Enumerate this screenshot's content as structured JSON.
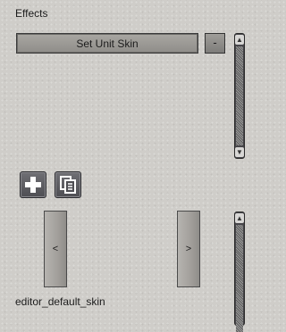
{
  "effects": {
    "title": "Effects",
    "current_effect_label": "Set Unit Skin",
    "remove_label": "-"
  },
  "scroll": {
    "up_glyph": "▲",
    "down_glyph": "▼"
  },
  "toolbar": {
    "add_icon": "plus-icon",
    "duplicate_icon": "duplicate-icon"
  },
  "nav": {
    "prev_label": "<",
    "next_label": ">"
  },
  "skin": {
    "name": "editor_default_skin"
  }
}
